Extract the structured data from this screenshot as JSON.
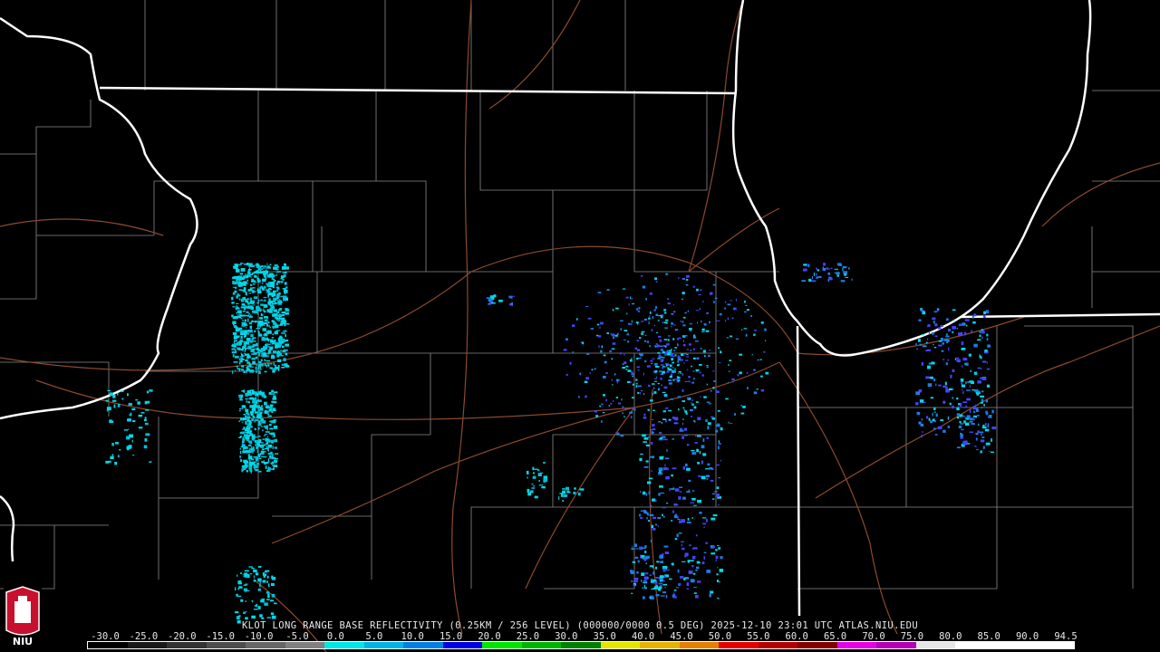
{
  "caption": "KLOT LONG RANGE BASE REFLECTIVITY (0.25KM / 256 LEVEL) (000000/0000 0.5 DEG) 2025-12-10 23:01 UTC  ATLAS.NIU.EDU",
  "logo": {
    "text": "NIU",
    "color_primary": "#c8102e",
    "color_secondary": "#ffffff"
  },
  "colorbar": {
    "labels": [
      "-30.0",
      "-25.0",
      "-20.0",
      "-15.0",
      "-10.0",
      "-5.0",
      "0.0",
      "5.0",
      "10.0",
      "15.0",
      "20.0",
      "25.0",
      "30.0",
      "35.0",
      "40.0",
      "45.0",
      "50.0",
      "55.0",
      "60.0",
      "65.0",
      "70.0",
      "75.0",
      "80.0",
      "85.0",
      "90.0",
      "94.5"
    ],
    "colors": [
      "#000000",
      "#1a1a1a",
      "#333333",
      "#4d4d4d",
      "#666666",
      "#808080",
      "#00e5e5",
      "#00b3e5",
      "#0080e5",
      "#0000e5",
      "#00e500",
      "#00b300",
      "#008000",
      "#e5e500",
      "#e5b300",
      "#e58000",
      "#e50000",
      "#b30000",
      "#800000",
      "#e500e5",
      "#b300b3",
      "#e5e5e5",
      "#ffffff",
      "#ffffff",
      "#ffffff"
    ]
  },
  "colors": {
    "background": "#000000",
    "state_border": "#ffffff",
    "county_border": "#8a8a8a",
    "highway": "#8b4a2e",
    "echo_light": "#00d8e8",
    "echo_medium": "#1a7fe6",
    "echo_strong": "#4444ff"
  }
}
